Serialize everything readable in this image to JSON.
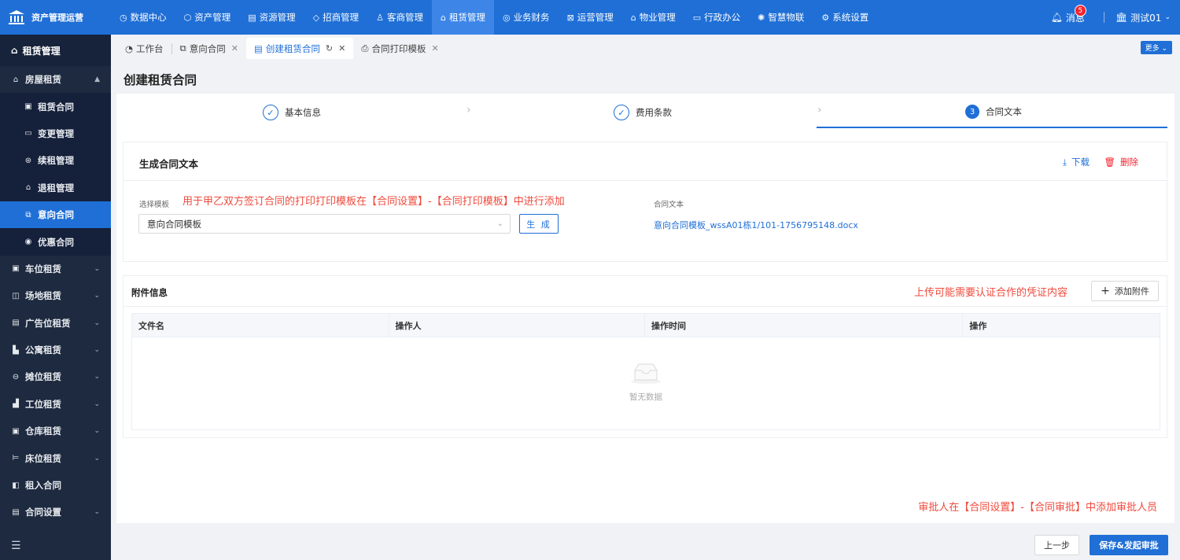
{
  "app": {
    "title": "资产管理运营"
  },
  "nav": [
    {
      "icon": "◷",
      "label": "数据中心"
    },
    {
      "icon": "⬡",
      "label": "资产管理"
    },
    {
      "icon": "▤",
      "label": "资源管理"
    },
    {
      "icon": "◇",
      "label": "招商管理"
    },
    {
      "icon": "♙",
      "label": "客商管理"
    },
    {
      "icon": "⌂",
      "label": "租赁管理"
    },
    {
      "icon": "◎",
      "label": "业务财务"
    },
    {
      "icon": "⊠",
      "label": "运营管理"
    },
    {
      "icon": "⌂",
      "label": "物业管理"
    },
    {
      "icon": "▭",
      "label": "行政办公"
    },
    {
      "icon": "✺",
      "label": "智慧物联"
    },
    {
      "icon": "⚙",
      "label": "系统设置"
    }
  ],
  "header_right": {
    "messages_label": "消息",
    "messages_count": "5",
    "user_label": "测试01"
  },
  "sidebar": {
    "title": "租赁管理",
    "items": [
      {
        "label": "房屋租赁",
        "icon": "⌂"
      },
      {
        "label": "租赁合同",
        "icon": "▣"
      },
      {
        "label": "变更管理",
        "icon": "▭"
      },
      {
        "label": "续租管理",
        "icon": "⊛"
      },
      {
        "label": "退租管理",
        "icon": "⌂"
      },
      {
        "label": "意向合同",
        "icon": "⧉"
      },
      {
        "label": "优惠合同",
        "icon": "◉"
      },
      {
        "label": "车位租赁",
        "icon": "▣"
      },
      {
        "label": "场地租赁",
        "icon": "◫"
      },
      {
        "label": "广告位租赁",
        "icon": "▤"
      },
      {
        "label": "公寓租赁",
        "icon": "▙"
      },
      {
        "label": "摊位租赁",
        "icon": "⊖"
      },
      {
        "label": "工位租赁",
        "icon": "▟"
      },
      {
        "label": "仓库租赁",
        "icon": "▣"
      },
      {
        "label": "床位租赁",
        "icon": "⊨"
      },
      {
        "label": "租入合同",
        "icon": "◧"
      },
      {
        "label": "合同设置",
        "icon": "▤"
      }
    ]
  },
  "tabs": [
    {
      "label": "工作台"
    },
    {
      "label": "意向合同"
    },
    {
      "label": "创建租赁合同"
    },
    {
      "label": "合同打印模板"
    }
  ],
  "more_label": "更多",
  "page": {
    "title": "创建租赁合同"
  },
  "steps": [
    {
      "label": "基本信息"
    },
    {
      "label": "费用条款"
    },
    {
      "label": "合同文本",
      "num": "3"
    }
  ],
  "contract_card": {
    "title": "生成合同文本",
    "download": "下载",
    "delete": "删除",
    "template_label": "选择模板",
    "hint": "用于甲乙双方签订合同的打印打印模板在【合同设置】-【合同打印模板】中进行添加",
    "template_value": "意向合同模板",
    "generate": "生 成",
    "text_label": "合同文本",
    "file": "意向合同模板_wssA01栋1/101-1756795148.docx"
  },
  "attach_card": {
    "title": "附件信息",
    "hint": "上传可能需要认证合作的凭证内容",
    "add": "添加附件",
    "columns": [
      "文件名",
      "操作人",
      "操作时间",
      "操作"
    ],
    "empty": "暂无数据"
  },
  "footer": {
    "hint": "审批人在【合同设置】-【合同审批】中添加审批人员",
    "prev": "上一步",
    "save": "保存&发起审批"
  }
}
